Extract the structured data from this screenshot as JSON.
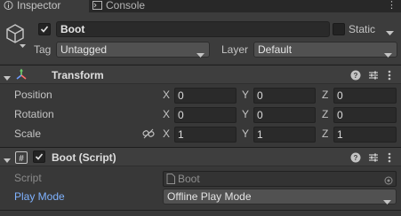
{
  "tabs": [
    {
      "label": "Inspector",
      "icon": "info-icon"
    },
    {
      "label": "Console",
      "icon": "console-icon"
    }
  ],
  "header": {
    "active": true,
    "object_name": "Boot",
    "static_label": "Static",
    "static_checked": false,
    "tag_label": "Tag",
    "tag_value": "Untagged",
    "layer_label": "Layer",
    "layer_value": "Default"
  },
  "transform": {
    "title": "Transform",
    "rows": [
      {
        "label": "Position",
        "x": "0",
        "y": "0",
        "z": "0"
      },
      {
        "label": "Rotation",
        "x": "0",
        "y": "0",
        "z": "0"
      },
      {
        "label": "Scale",
        "x": "1",
        "y": "1",
        "z": "1"
      }
    ],
    "axis_labels": {
      "x": "X",
      "y": "Y",
      "z": "Z"
    }
  },
  "script_component": {
    "title": "Boot (Script)",
    "enabled": true,
    "script_label": "Script",
    "script_value": "Boot",
    "play_mode_label": "Play Mode",
    "play_mode_value": "Offline Play Mode"
  },
  "colors": {
    "accent_blue": "#7fb2ff",
    "panel_bg": "#383838",
    "header_bg": "#3e3e3e"
  }
}
